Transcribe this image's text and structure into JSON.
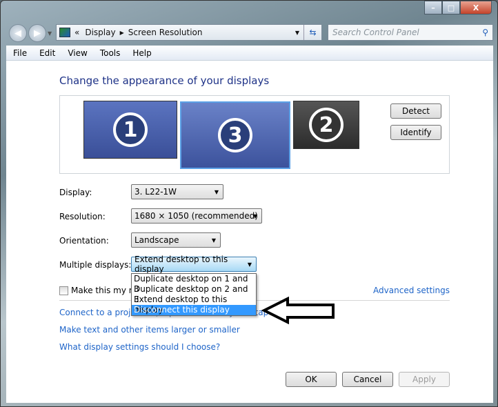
{
  "window": {
    "minimize": "–",
    "maximize": "□",
    "close": "X"
  },
  "address": {
    "prefix": "«",
    "crumbs": [
      "Display",
      "Screen Resolution"
    ],
    "search_placeholder": "Search Control Panel"
  },
  "menu": [
    "File",
    "Edit",
    "View",
    "Tools",
    "Help"
  ],
  "main": {
    "title": "Change the appearance of your displays",
    "monitors": [
      {
        "num": "1"
      },
      {
        "num": "3"
      },
      {
        "num": "2"
      }
    ],
    "detect": "Detect",
    "identify": "Identify",
    "display_label": "Display:",
    "display_value": "3. L22-1W",
    "resolution_label": "Resolution:",
    "resolution_value": "1680 × 1050 (recommended)",
    "orientation_label": "Orientation:",
    "orientation_value": "Landscape",
    "multiple_label": "Multiple displays:",
    "multiple_value": "Extend desktop to this display",
    "multiple_options": [
      "Duplicate desktop on 1 and 3",
      "Duplicate desktop on 2 and 3",
      "Extend desktop to this display",
      "Disconnect this display"
    ],
    "main_checkbox": "Make this my main display",
    "advanced": "Advanced settings",
    "links": [
      "Connect to a projector (or press the ⊞ key and tap P)",
      "Make text and other items larger or smaller",
      "What display settings should I choose?"
    ],
    "ok": "OK",
    "cancel": "Cancel",
    "apply": "Apply"
  }
}
